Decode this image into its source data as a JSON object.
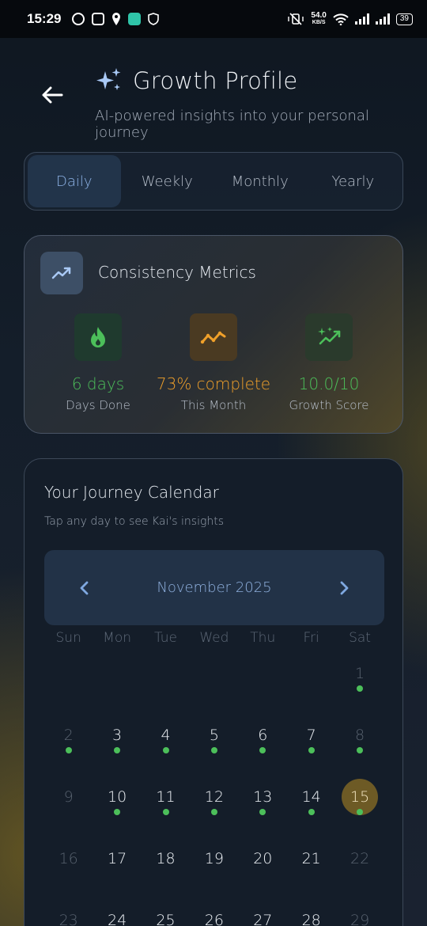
{
  "status_bar": {
    "time": "15:29",
    "net_speed_value": "54.0",
    "net_speed_unit": "KB/S",
    "battery": "39"
  },
  "header": {
    "back_icon": "arrow-left-icon",
    "sparkle_icon": "sparkles-icon",
    "title": "Growth Profile",
    "subtitle": "AI-powered insights into your personal journey"
  },
  "tabs": [
    {
      "label": "Daily",
      "active": true
    },
    {
      "label": "Weekly",
      "active": false
    },
    {
      "label": "Monthly",
      "active": false
    },
    {
      "label": "Yearly",
      "active": false
    }
  ],
  "metrics": {
    "title": "Consistency Metrics",
    "icon": "trending-up-icon",
    "items": [
      {
        "value": "6 days",
        "label": "Days Done",
        "icon": "flame-icon",
        "color": "#4cbf5a",
        "icon_bg": "#1f3a2e"
      },
      {
        "value": "73% complete",
        "label": "This Month",
        "icon": "trend-line-icon",
        "color": "#f0a02a",
        "icon_bg": "#4a3a22"
      },
      {
        "value": "10.0/10",
        "label": "Growth Score",
        "icon": "sparkle-trend-icon",
        "color": "#4cbf5a",
        "icon_bg": "#2a3a2c"
      }
    ]
  },
  "calendar": {
    "title": "Your Journey Calendar",
    "hint": "Tap any day to see Kai's insights",
    "month_label": "November 2025",
    "weekdays": [
      "Sun",
      "Mon",
      "Tue",
      "Wed",
      "Thu",
      "Fri",
      "Sat"
    ],
    "days": [
      {
        "n": "1",
        "col": 6,
        "row": 0,
        "dim": true,
        "dot": true
      },
      {
        "n": "2",
        "col": 0,
        "row": 1,
        "dim": true,
        "dot": true
      },
      {
        "n": "3",
        "col": 1,
        "row": 1,
        "dim": false,
        "dot": true
      },
      {
        "n": "4",
        "col": 2,
        "row": 1,
        "dim": false,
        "dot": true
      },
      {
        "n": "5",
        "col": 3,
        "row": 1,
        "dim": false,
        "dot": true
      },
      {
        "n": "6",
        "col": 4,
        "row": 1,
        "dim": false,
        "dot": true
      },
      {
        "n": "7",
        "col": 5,
        "row": 1,
        "dim": false,
        "dot": true
      },
      {
        "n": "8",
        "col": 6,
        "row": 1,
        "dim": true,
        "dot": true
      },
      {
        "n": "9",
        "col": 0,
        "row": 2,
        "dim": true,
        "dot": false
      },
      {
        "n": "10",
        "col": 1,
        "row": 2,
        "dim": false,
        "dot": true
      },
      {
        "n": "11",
        "col": 2,
        "row": 2,
        "dim": false,
        "dot": true
      },
      {
        "n": "12",
        "col": 3,
        "row": 2,
        "dim": false,
        "dot": true
      },
      {
        "n": "13",
        "col": 4,
        "row": 2,
        "dim": false,
        "dot": true
      },
      {
        "n": "14",
        "col": 5,
        "row": 2,
        "dim": false,
        "dot": true
      },
      {
        "n": "15",
        "col": 6,
        "row": 2,
        "dim": false,
        "dot": true,
        "today": true
      },
      {
        "n": "16",
        "col": 0,
        "row": 3,
        "dim": true,
        "dot": false
      },
      {
        "n": "17",
        "col": 1,
        "row": 3,
        "dim": false,
        "dot": false
      },
      {
        "n": "18",
        "col": 2,
        "row": 3,
        "dim": false,
        "dot": false
      },
      {
        "n": "19",
        "col": 3,
        "row": 3,
        "dim": false,
        "dot": false
      },
      {
        "n": "20",
        "col": 4,
        "row": 3,
        "dim": false,
        "dot": false
      },
      {
        "n": "21",
        "col": 5,
        "row": 3,
        "dim": false,
        "dot": false
      },
      {
        "n": "22",
        "col": 6,
        "row": 3,
        "dim": true,
        "dot": false
      },
      {
        "n": "23",
        "col": 0,
        "row": 4,
        "dim": true,
        "dot": false
      },
      {
        "n": "24",
        "col": 1,
        "row": 4,
        "dim": false,
        "dot": false
      },
      {
        "n": "25",
        "col": 2,
        "row": 4,
        "dim": false,
        "dot": false
      },
      {
        "n": "26",
        "col": 3,
        "row": 4,
        "dim": false,
        "dot": false
      },
      {
        "n": "27",
        "col": 4,
        "row": 4,
        "dim": false,
        "dot": false
      },
      {
        "n": "28",
        "col": 5,
        "row": 4,
        "dim": false,
        "dot": false
      },
      {
        "n": "29",
        "col": 6,
        "row": 4,
        "dim": true,
        "dot": false
      }
    ]
  }
}
